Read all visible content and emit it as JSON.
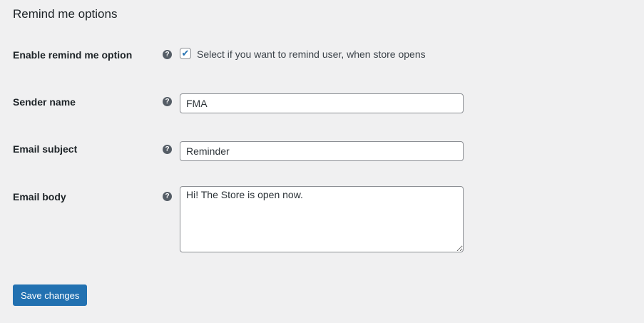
{
  "title": "Remind me options",
  "fields": {
    "enable": {
      "label": "Enable remind me option",
      "checkbox_text": "Select if you want to remind user, when store opens",
      "checked": true
    },
    "sender": {
      "label": "Sender name",
      "value": "FMA"
    },
    "subject": {
      "label": "Email subject",
      "value": "Reminder"
    },
    "body": {
      "label": "Email body",
      "value": "Hi! The Store is open now."
    }
  },
  "help_glyph": "?",
  "check_glyph": "✔",
  "save_label": "Save changes"
}
